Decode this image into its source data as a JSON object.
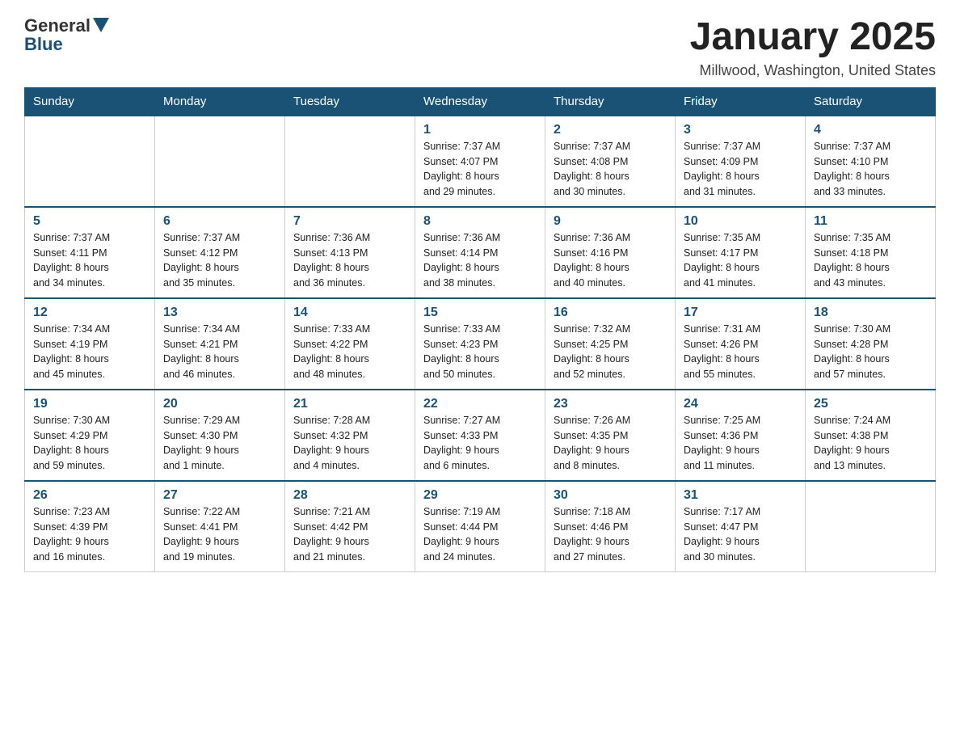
{
  "header": {
    "logo_general": "General",
    "logo_blue": "Blue",
    "main_title": "January 2025",
    "subtitle": "Millwood, Washington, United States"
  },
  "days_of_week": [
    "Sunday",
    "Monday",
    "Tuesday",
    "Wednesday",
    "Thursday",
    "Friday",
    "Saturday"
  ],
  "weeks": [
    [
      {
        "day": "",
        "info": ""
      },
      {
        "day": "",
        "info": ""
      },
      {
        "day": "",
        "info": ""
      },
      {
        "day": "1",
        "info": "Sunrise: 7:37 AM\nSunset: 4:07 PM\nDaylight: 8 hours\nand 29 minutes."
      },
      {
        "day": "2",
        "info": "Sunrise: 7:37 AM\nSunset: 4:08 PM\nDaylight: 8 hours\nand 30 minutes."
      },
      {
        "day": "3",
        "info": "Sunrise: 7:37 AM\nSunset: 4:09 PM\nDaylight: 8 hours\nand 31 minutes."
      },
      {
        "day": "4",
        "info": "Sunrise: 7:37 AM\nSunset: 4:10 PM\nDaylight: 8 hours\nand 33 minutes."
      }
    ],
    [
      {
        "day": "5",
        "info": "Sunrise: 7:37 AM\nSunset: 4:11 PM\nDaylight: 8 hours\nand 34 minutes."
      },
      {
        "day": "6",
        "info": "Sunrise: 7:37 AM\nSunset: 4:12 PM\nDaylight: 8 hours\nand 35 minutes."
      },
      {
        "day": "7",
        "info": "Sunrise: 7:36 AM\nSunset: 4:13 PM\nDaylight: 8 hours\nand 36 minutes."
      },
      {
        "day": "8",
        "info": "Sunrise: 7:36 AM\nSunset: 4:14 PM\nDaylight: 8 hours\nand 38 minutes."
      },
      {
        "day": "9",
        "info": "Sunrise: 7:36 AM\nSunset: 4:16 PM\nDaylight: 8 hours\nand 40 minutes."
      },
      {
        "day": "10",
        "info": "Sunrise: 7:35 AM\nSunset: 4:17 PM\nDaylight: 8 hours\nand 41 minutes."
      },
      {
        "day": "11",
        "info": "Sunrise: 7:35 AM\nSunset: 4:18 PM\nDaylight: 8 hours\nand 43 minutes."
      }
    ],
    [
      {
        "day": "12",
        "info": "Sunrise: 7:34 AM\nSunset: 4:19 PM\nDaylight: 8 hours\nand 45 minutes."
      },
      {
        "day": "13",
        "info": "Sunrise: 7:34 AM\nSunset: 4:21 PM\nDaylight: 8 hours\nand 46 minutes."
      },
      {
        "day": "14",
        "info": "Sunrise: 7:33 AM\nSunset: 4:22 PM\nDaylight: 8 hours\nand 48 minutes."
      },
      {
        "day": "15",
        "info": "Sunrise: 7:33 AM\nSunset: 4:23 PM\nDaylight: 8 hours\nand 50 minutes."
      },
      {
        "day": "16",
        "info": "Sunrise: 7:32 AM\nSunset: 4:25 PM\nDaylight: 8 hours\nand 52 minutes."
      },
      {
        "day": "17",
        "info": "Sunrise: 7:31 AM\nSunset: 4:26 PM\nDaylight: 8 hours\nand 55 minutes."
      },
      {
        "day": "18",
        "info": "Sunrise: 7:30 AM\nSunset: 4:28 PM\nDaylight: 8 hours\nand 57 minutes."
      }
    ],
    [
      {
        "day": "19",
        "info": "Sunrise: 7:30 AM\nSunset: 4:29 PM\nDaylight: 8 hours\nand 59 minutes."
      },
      {
        "day": "20",
        "info": "Sunrise: 7:29 AM\nSunset: 4:30 PM\nDaylight: 9 hours\nand 1 minute."
      },
      {
        "day": "21",
        "info": "Sunrise: 7:28 AM\nSunset: 4:32 PM\nDaylight: 9 hours\nand 4 minutes."
      },
      {
        "day": "22",
        "info": "Sunrise: 7:27 AM\nSunset: 4:33 PM\nDaylight: 9 hours\nand 6 minutes."
      },
      {
        "day": "23",
        "info": "Sunrise: 7:26 AM\nSunset: 4:35 PM\nDaylight: 9 hours\nand 8 minutes."
      },
      {
        "day": "24",
        "info": "Sunrise: 7:25 AM\nSunset: 4:36 PM\nDaylight: 9 hours\nand 11 minutes."
      },
      {
        "day": "25",
        "info": "Sunrise: 7:24 AM\nSunset: 4:38 PM\nDaylight: 9 hours\nand 13 minutes."
      }
    ],
    [
      {
        "day": "26",
        "info": "Sunrise: 7:23 AM\nSunset: 4:39 PM\nDaylight: 9 hours\nand 16 minutes."
      },
      {
        "day": "27",
        "info": "Sunrise: 7:22 AM\nSunset: 4:41 PM\nDaylight: 9 hours\nand 19 minutes."
      },
      {
        "day": "28",
        "info": "Sunrise: 7:21 AM\nSunset: 4:42 PM\nDaylight: 9 hours\nand 21 minutes."
      },
      {
        "day": "29",
        "info": "Sunrise: 7:19 AM\nSunset: 4:44 PM\nDaylight: 9 hours\nand 24 minutes."
      },
      {
        "day": "30",
        "info": "Sunrise: 7:18 AM\nSunset: 4:46 PM\nDaylight: 9 hours\nand 27 minutes."
      },
      {
        "day": "31",
        "info": "Sunrise: 7:17 AM\nSunset: 4:47 PM\nDaylight: 9 hours\nand 30 minutes."
      },
      {
        "day": "",
        "info": ""
      }
    ]
  ]
}
